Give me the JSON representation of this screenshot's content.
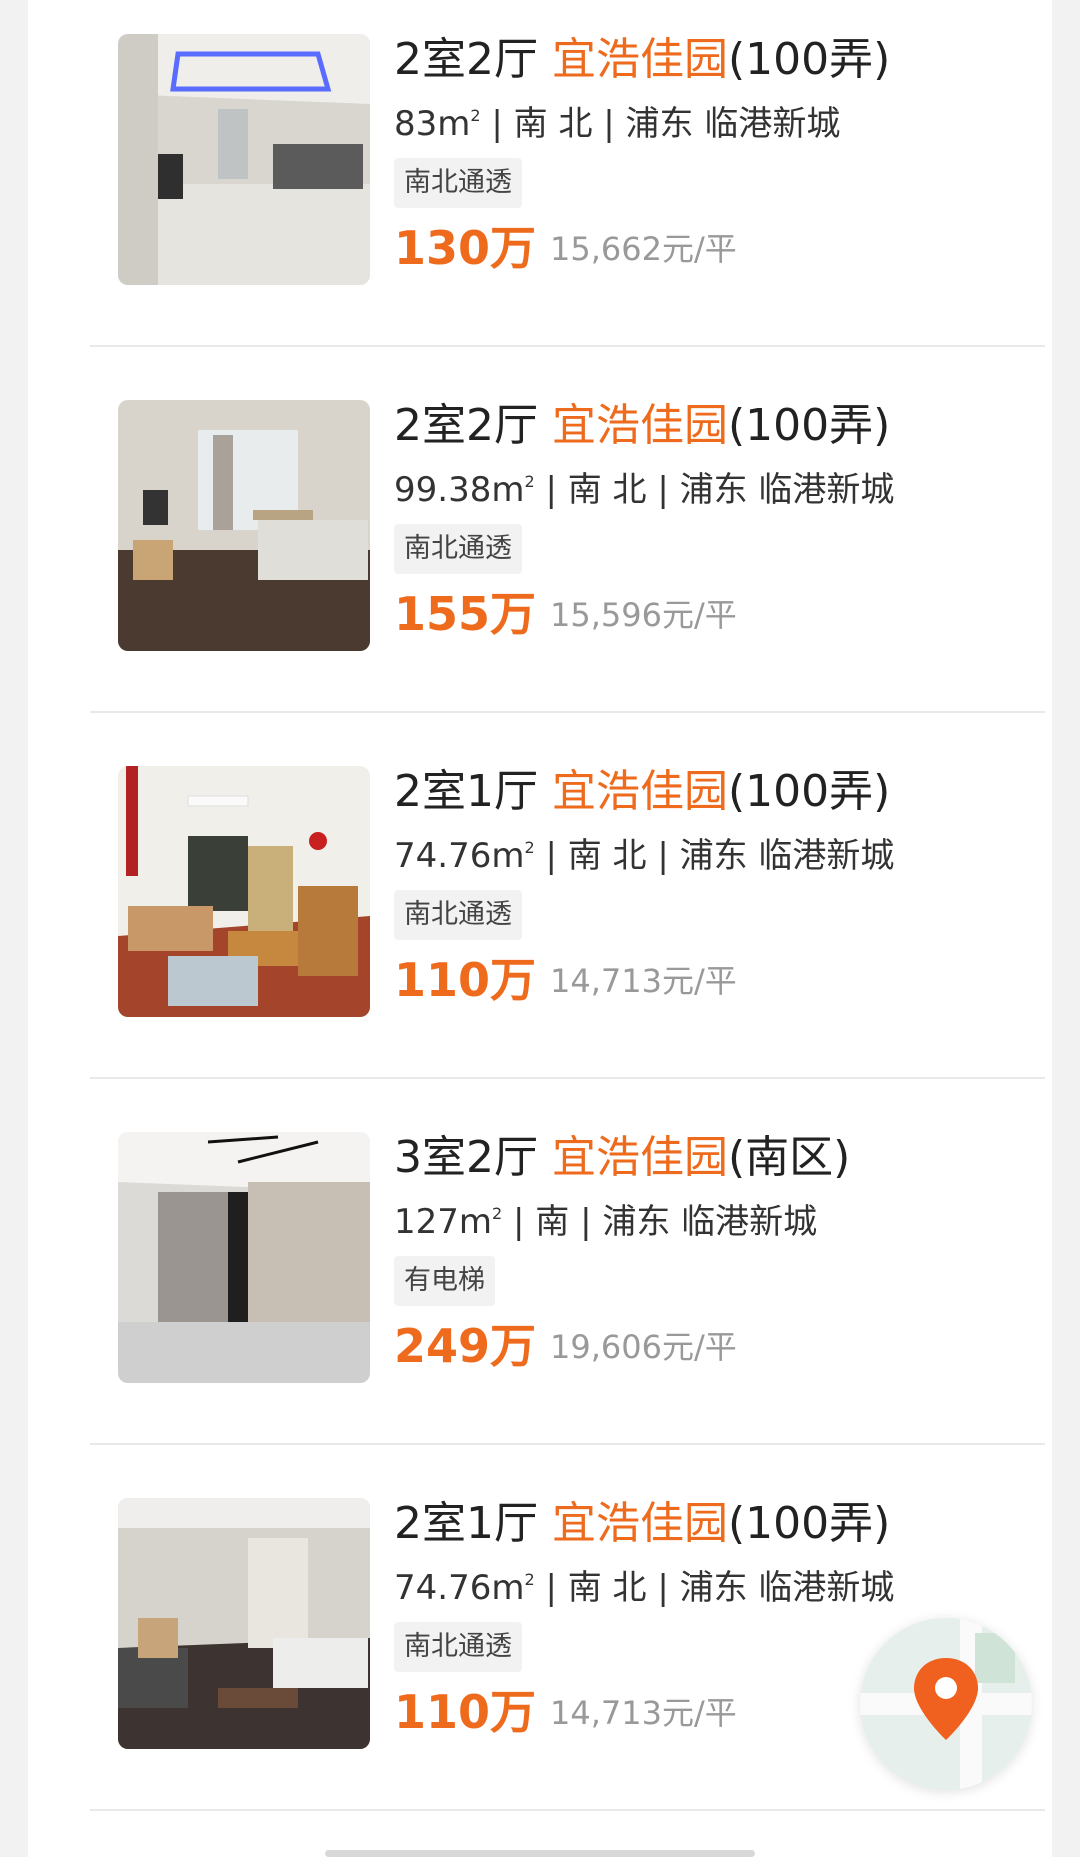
{
  "listings": [
    {
      "layout": "2室2厅",
      "community": "宜浩佳园",
      "community_suffix": "(100弄)",
      "area_value": "83m",
      "area_sup": "2",
      "orientation": "南 北",
      "district": "浦东 临港新城",
      "tag": "南北通透",
      "price": "130万",
      "unit_price": "15,662元/平"
    },
    {
      "layout": "2室2厅",
      "community": "宜浩佳园",
      "community_suffix": "(100弄)",
      "area_value": "99.38m",
      "area_sup": "2",
      "orientation": "南 北",
      "district": "浦东 临港新城",
      "tag": "南北通透",
      "price": "155万",
      "unit_price": "15,596元/平"
    },
    {
      "layout": "2室1厅",
      "community": "宜浩佳园",
      "community_suffix": "(100弄)",
      "area_value": "74.76m",
      "area_sup": "2",
      "orientation": "南 北",
      "district": "浦东 临港新城",
      "tag": "南北通透",
      "price": "110万",
      "unit_price": "14,713元/平"
    },
    {
      "layout": "3室2厅",
      "community": "宜浩佳园",
      "community_suffix": "(南区)",
      "area_value": "127m",
      "area_sup": "2",
      "orientation": "南",
      "district": "浦东 临港新城",
      "tag": "有电梯",
      "price": "249万",
      "unit_price": "19,606元/平"
    },
    {
      "layout": "2室1厅",
      "community": "宜浩佳园",
      "community_suffix": "(100弄)",
      "area_value": "74.76m",
      "area_sup": "2",
      "orientation": "南 北",
      "district": "浦东 临港新城",
      "tag": "南北通透",
      "price": "110万",
      "unit_price": "14,713元/平"
    }
  ],
  "colors": {
    "accent": "#ee6a1c",
    "text": "#222222",
    "muted": "#999999",
    "tag_bg": "#f2f2f2"
  },
  "map_button": {
    "icon": "location-pin-icon"
  }
}
